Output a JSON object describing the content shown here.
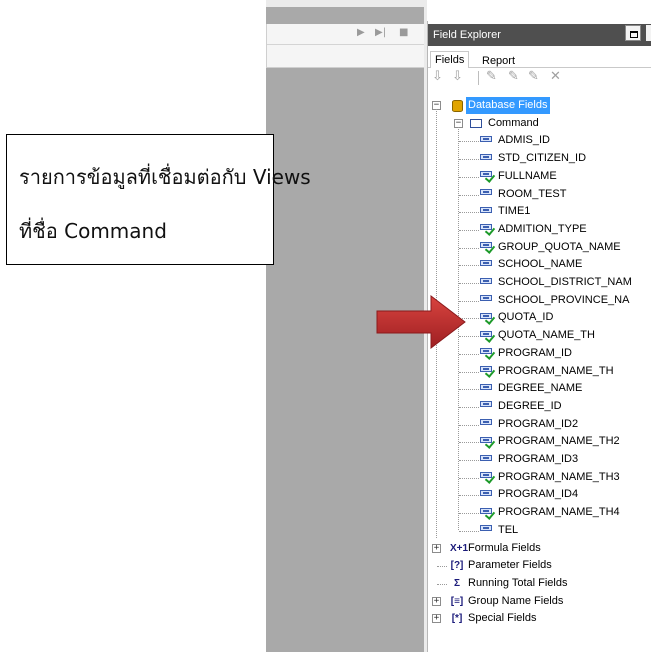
{
  "callout": {
    "line1": "รายการข้อมูลที่เชื่อมต่อกับ Views",
    "line2": "ที่ชื่อ Command"
  },
  "editor": {
    "controls": [
      "▶",
      "▶|",
      "■"
    ]
  },
  "field_explorer": {
    "title": "Field Explorer",
    "tabs": [
      "Fields",
      "Report"
    ],
    "toolbar_icons": [
      "insert-field-icon",
      "browse-data-icon",
      "new-formula-icon",
      "edit-icon",
      "rename-icon",
      "delete-icon"
    ],
    "toolbar_glyphs": [
      "⇩",
      "⇩",
      "✎",
      "✎",
      "✎",
      "✕"
    ],
    "tree": {
      "database_fields": "Database Fields",
      "command": "Command",
      "fields": [
        {
          "name": "ADMIS_ID",
          "used": false
        },
        {
          "name": "STD_CITIZEN_ID",
          "used": false
        },
        {
          "name": "FULLNAME",
          "used": true
        },
        {
          "name": "ROOM_TEST",
          "used": false
        },
        {
          "name": "TIME1",
          "used": false
        },
        {
          "name": "ADMITION_TYPE",
          "used": true
        },
        {
          "name": "GROUP_QUOTA_NAME",
          "used": true
        },
        {
          "name": "SCHOOL_NAME",
          "used": false
        },
        {
          "name": "SCHOOL_DISTRICT_NAM",
          "used": false
        },
        {
          "name": "SCHOOL_PROVINCE_NA",
          "used": false
        },
        {
          "name": "QUOTA_ID",
          "used": true
        },
        {
          "name": "QUOTA_NAME_TH",
          "used": true
        },
        {
          "name": "PROGRAM_ID",
          "used": true
        },
        {
          "name": "PROGRAM_NAME_TH",
          "used": true
        },
        {
          "name": "DEGREE_NAME",
          "used": false
        },
        {
          "name": "DEGREE_ID",
          "used": false
        },
        {
          "name": "PROGRAM_ID2",
          "used": false
        },
        {
          "name": "PROGRAM_NAME_TH2",
          "used": true
        },
        {
          "name": "PROGRAM_ID3",
          "used": false
        },
        {
          "name": "PROGRAM_NAME_TH3",
          "used": true
        },
        {
          "name": "PROGRAM_ID4",
          "used": false
        },
        {
          "name": "PROGRAM_NAME_TH4",
          "used": true
        },
        {
          "name": "TEL",
          "used": false
        }
      ],
      "groups": [
        {
          "label": "Formula Fields",
          "icon": "X+1",
          "expandable": true
        },
        {
          "label": "Parameter Fields",
          "icon": "[?]",
          "expandable": false
        },
        {
          "label": "Running Total Fields",
          "icon": "Σ",
          "expandable": false
        },
        {
          "label": "Group Name Fields",
          "icon": "[≡]",
          "expandable": true
        },
        {
          "label": "Special Fields",
          "icon": "[*]",
          "expandable": true
        }
      ]
    }
  },
  "colors": {
    "editor_bg": "#a9a9a9",
    "title_bar": "#4f4f4f",
    "selection": "#3399ff",
    "arrow": "#c0282a",
    "check": "#1d9a2a"
  }
}
